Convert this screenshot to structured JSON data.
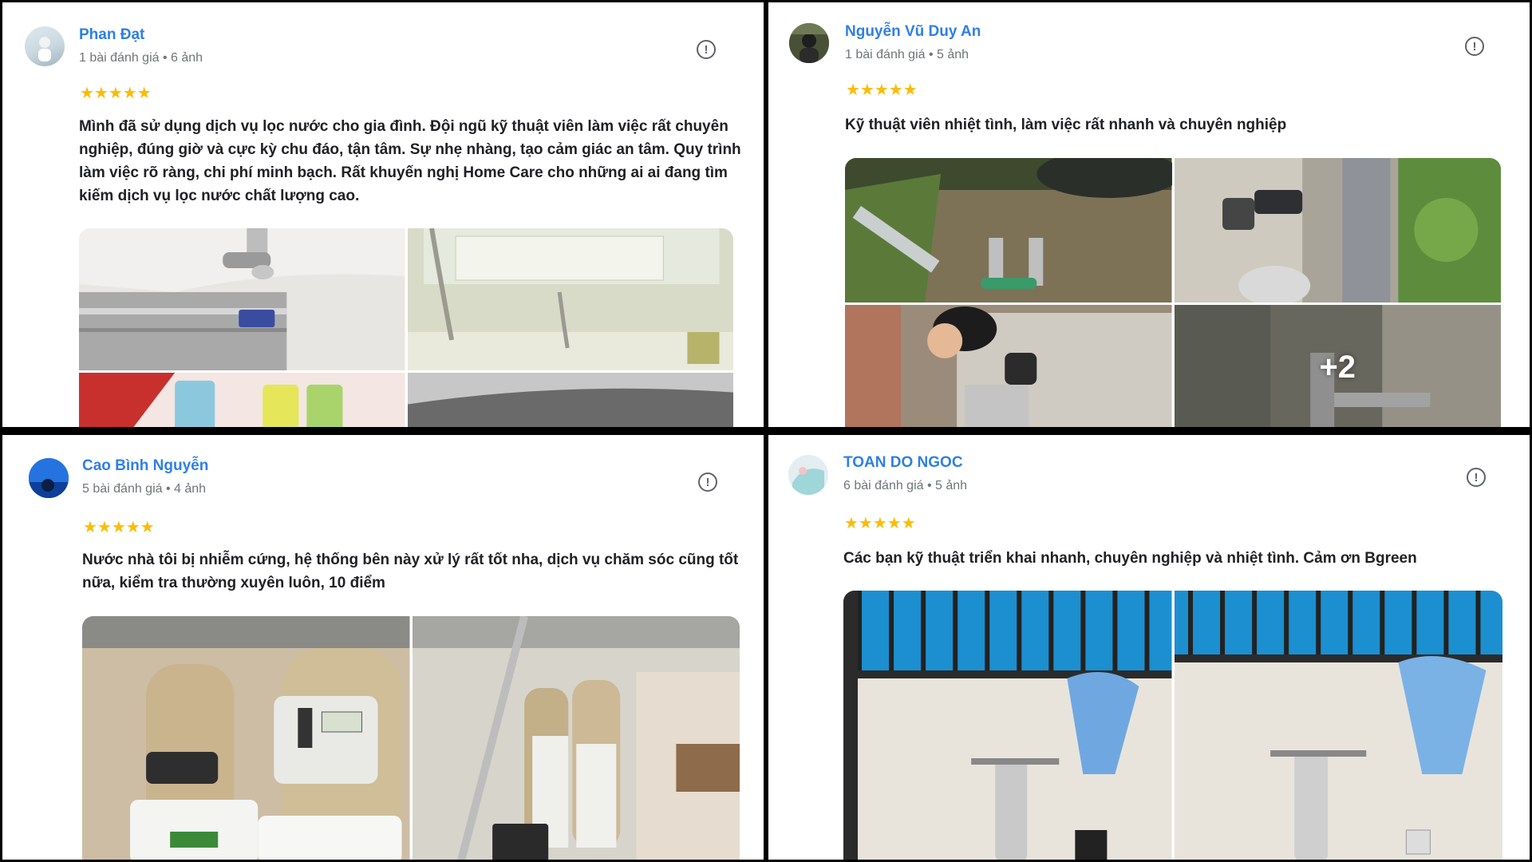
{
  "reviews": [
    {
      "name": "Phan Đạt",
      "meta": "1 bài đánh giá • 6 ảnh",
      "stars": "★★★★★",
      "text": "Mình đã sử dụng dịch vụ lọc nước cho gia đình. Đội ngũ kỹ thuật viên làm việc rất chuyên nghiệp, đúng giờ và cực kỳ chu đáo, tận tâm. Sự nhẹ nhàng, tạo cảm giác an tâm. Quy trình làm việc rõ ràng, chi phí minh bạch. Rất khuyến nghị Home Care cho những ai ai đang tìm kiếm dịch vụ lọc nước chất lượng cao.",
      "report_icon": "!"
    },
    {
      "name": "Nguyễn Vũ Duy An",
      "meta": "1 bài đánh giá • 5 ảnh",
      "stars": "★★★★★",
      "text": "Kỹ thuật viên nhiệt tình, làm việc rất nhanh và chuyên nghiệp",
      "report_icon": "!",
      "more_photos": "+2"
    },
    {
      "name": "Cao Bình Nguyễn",
      "meta": "5 bài đánh giá • 4 ảnh",
      "stars": "★★★★★",
      "text": "Nước nhà tôi bị nhiễm cứng, hệ thống bên này xử lý rất tốt nha, dịch vụ chăm sóc cũng tốt nữa, kiểm tra thường xuyên luôn, 10 điểm",
      "report_icon": "!"
    },
    {
      "name": "TOAN DO NGOC",
      "meta": "6 bài đánh giá • 5 ảnh",
      "stars": "★★★★★",
      "text": "Các bạn kỹ thuật triển khai nhanh, chuyên nghiệp và nhiệt tình. Cảm ơn Bgreen",
      "report_icon": "!"
    }
  ],
  "colors": {
    "name": "#2f7fe6",
    "meta": "#70757a",
    "star": "#fbbc04",
    "text": "#202124"
  }
}
